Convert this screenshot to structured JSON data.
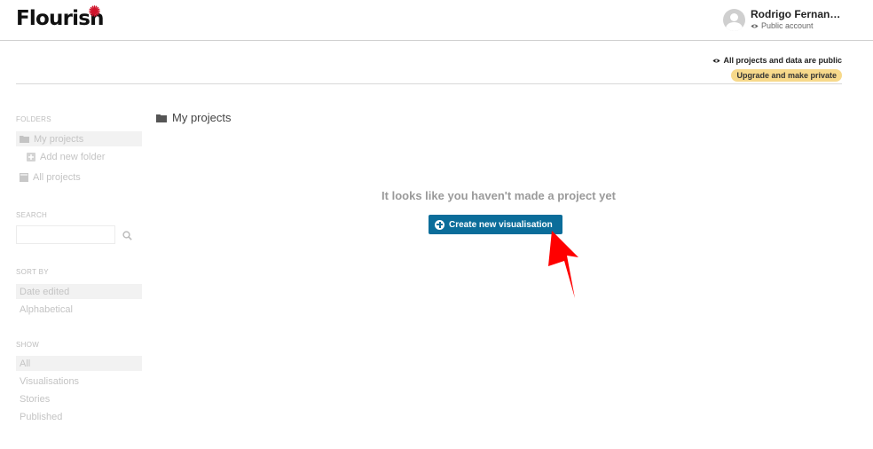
{
  "header": {
    "logo_text": "Flourish",
    "user_name": "Rodrigo Fernan…",
    "account_type": "Public account"
  },
  "privacy": {
    "notice": "All projects and data are public",
    "upgrade_label": "Upgrade and make private"
  },
  "sidebar": {
    "folders_title": "FOLDERS",
    "folders": [
      {
        "label": "My projects",
        "icon": "folder-icon",
        "active": true
      },
      {
        "label": "Add new folder",
        "icon": "plus-square-icon",
        "active": false
      },
      {
        "label": "All projects",
        "icon": "archive-icon",
        "active": false
      }
    ],
    "search_title": "SEARCH",
    "search_placeholder": "",
    "sort_title": "SORT BY",
    "sort_options": [
      {
        "label": "Date edited",
        "active": true
      },
      {
        "label": "Alphabetical",
        "active": false
      }
    ],
    "show_title": "SHOW",
    "show_options": [
      {
        "label": "All",
        "active": true
      },
      {
        "label": "Visualisations",
        "active": false
      },
      {
        "label": "Stories",
        "active": false
      },
      {
        "label": "Published",
        "active": false
      }
    ]
  },
  "main": {
    "breadcrumb": "My projects",
    "empty_message": "It looks like you haven't made a project yet",
    "create_label": "Create new visualisation"
  },
  "colors": {
    "primary_button": "#0b6d9a",
    "upgrade_badge": "#f7d98b",
    "logo_star": "#d0132b",
    "arrow": "#ff0000"
  }
}
